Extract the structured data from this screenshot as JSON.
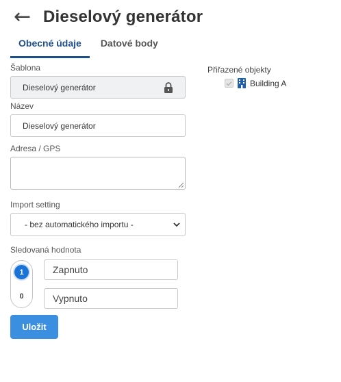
{
  "header": {
    "back_icon": "←",
    "title": "Dieselový generátor"
  },
  "tabs": [
    {
      "label": "Obecné údaje",
      "active": true
    },
    {
      "label": "Datové body",
      "active": false
    }
  ],
  "form": {
    "template": {
      "label": "Šablona",
      "value": "Dieselový generátor",
      "icon": "lock-icon"
    },
    "name": {
      "label": "Název",
      "value": "Dieselový generátor"
    },
    "address": {
      "label": "Adresa / GPS",
      "value": ""
    },
    "import": {
      "label": "Import setting",
      "value": "- bez automatického importu -"
    },
    "tracked": {
      "label": "Sledovaná hodnota",
      "on_value": "1",
      "off_value": "0",
      "on_label": "Zapnuto",
      "off_label": "Vypnuto",
      "selected": "1"
    },
    "save_label": "Uložit"
  },
  "assigned": {
    "title": "Přiřazené objekty",
    "items": [
      {
        "name": "Building A",
        "checked": true,
        "icon": "building-icon"
      }
    ]
  },
  "colors": {
    "accent": "#1f4e8c",
    "button": "#3b8fe0",
    "toggle_active": "#1a73d6",
    "building_icon": "#1f5fae"
  }
}
